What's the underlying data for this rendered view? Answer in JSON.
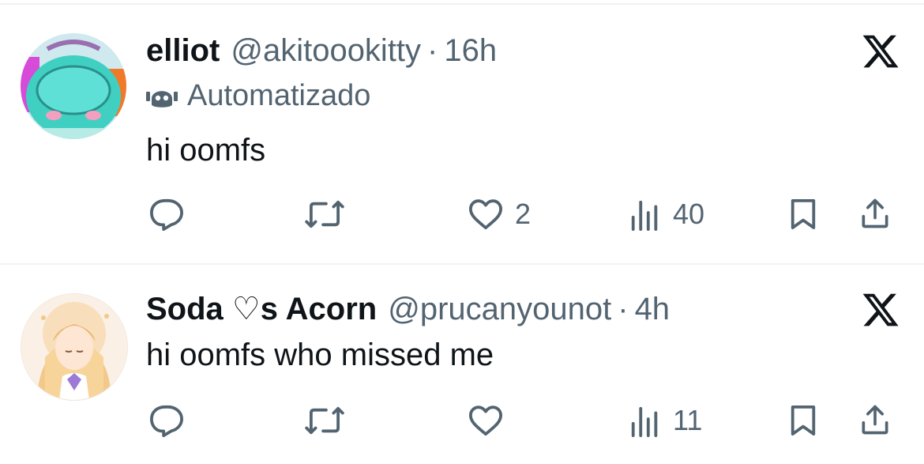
{
  "tweets": [
    {
      "display_name": "elliot",
      "handle": "@akitoookitty",
      "separator": "·",
      "time": "16h",
      "automated_label": "Automatizado",
      "text": "hi oomfs",
      "reply_icon": "reply-icon",
      "retweet_icon": "retweet-icon",
      "like_icon": "heart-icon",
      "like_count": "2",
      "views_icon": "views-icon",
      "views_count": "40",
      "bookmark_icon": "bookmark-icon",
      "share_icon": "share-icon"
    },
    {
      "display_name": "Soda ♡s Acorn",
      "handle": "@prucanyounot",
      "separator": "·",
      "time": "4h",
      "text": "hi oomfs who missed me",
      "reply_icon": "reply-icon",
      "retweet_icon": "retweet-icon",
      "like_icon": "heart-icon",
      "like_count": "",
      "views_icon": "views-icon",
      "views_count": "11",
      "bookmark_icon": "bookmark-icon",
      "share_icon": "share-icon"
    }
  ],
  "colors": {
    "text_primary": "#0f1419",
    "text_secondary": "#536471",
    "divider": "#eff3f4"
  }
}
